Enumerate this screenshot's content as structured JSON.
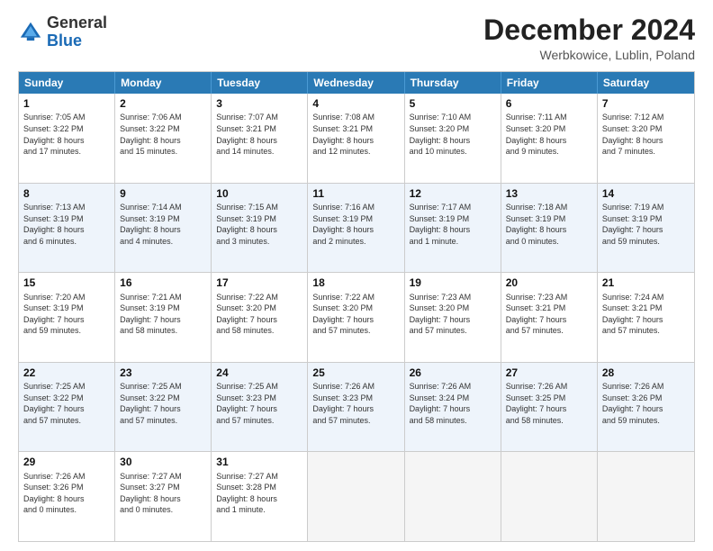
{
  "header": {
    "logo_general": "General",
    "logo_blue": "Blue",
    "month_title": "December 2024",
    "location": "Werbkowice, Lublin, Poland"
  },
  "weekdays": [
    "Sunday",
    "Monday",
    "Tuesday",
    "Wednesday",
    "Thursday",
    "Friday",
    "Saturday"
  ],
  "rows": [
    [
      {
        "day": "1",
        "lines": [
          "Sunrise: 7:05 AM",
          "Sunset: 3:22 PM",
          "Daylight: 8 hours",
          "and 17 minutes."
        ]
      },
      {
        "day": "2",
        "lines": [
          "Sunrise: 7:06 AM",
          "Sunset: 3:22 PM",
          "Daylight: 8 hours",
          "and 15 minutes."
        ]
      },
      {
        "day": "3",
        "lines": [
          "Sunrise: 7:07 AM",
          "Sunset: 3:21 PM",
          "Daylight: 8 hours",
          "and 14 minutes."
        ]
      },
      {
        "day": "4",
        "lines": [
          "Sunrise: 7:08 AM",
          "Sunset: 3:21 PM",
          "Daylight: 8 hours",
          "and 12 minutes."
        ]
      },
      {
        "day": "5",
        "lines": [
          "Sunrise: 7:10 AM",
          "Sunset: 3:20 PM",
          "Daylight: 8 hours",
          "and 10 minutes."
        ]
      },
      {
        "day": "6",
        "lines": [
          "Sunrise: 7:11 AM",
          "Sunset: 3:20 PM",
          "Daylight: 8 hours",
          "and 9 minutes."
        ]
      },
      {
        "day": "7",
        "lines": [
          "Sunrise: 7:12 AM",
          "Sunset: 3:20 PM",
          "Daylight: 8 hours",
          "and 7 minutes."
        ]
      }
    ],
    [
      {
        "day": "8",
        "lines": [
          "Sunrise: 7:13 AM",
          "Sunset: 3:19 PM",
          "Daylight: 8 hours",
          "and 6 minutes."
        ]
      },
      {
        "day": "9",
        "lines": [
          "Sunrise: 7:14 AM",
          "Sunset: 3:19 PM",
          "Daylight: 8 hours",
          "and 4 minutes."
        ]
      },
      {
        "day": "10",
        "lines": [
          "Sunrise: 7:15 AM",
          "Sunset: 3:19 PM",
          "Daylight: 8 hours",
          "and 3 minutes."
        ]
      },
      {
        "day": "11",
        "lines": [
          "Sunrise: 7:16 AM",
          "Sunset: 3:19 PM",
          "Daylight: 8 hours",
          "and 2 minutes."
        ]
      },
      {
        "day": "12",
        "lines": [
          "Sunrise: 7:17 AM",
          "Sunset: 3:19 PM",
          "Daylight: 8 hours",
          "and 1 minute."
        ]
      },
      {
        "day": "13",
        "lines": [
          "Sunrise: 7:18 AM",
          "Sunset: 3:19 PM",
          "Daylight: 8 hours",
          "and 0 minutes."
        ]
      },
      {
        "day": "14",
        "lines": [
          "Sunrise: 7:19 AM",
          "Sunset: 3:19 PM",
          "Daylight: 7 hours",
          "and 59 minutes."
        ]
      }
    ],
    [
      {
        "day": "15",
        "lines": [
          "Sunrise: 7:20 AM",
          "Sunset: 3:19 PM",
          "Daylight: 7 hours",
          "and 59 minutes."
        ]
      },
      {
        "day": "16",
        "lines": [
          "Sunrise: 7:21 AM",
          "Sunset: 3:19 PM",
          "Daylight: 7 hours",
          "and 58 minutes."
        ]
      },
      {
        "day": "17",
        "lines": [
          "Sunrise: 7:22 AM",
          "Sunset: 3:20 PM",
          "Daylight: 7 hours",
          "and 58 minutes."
        ]
      },
      {
        "day": "18",
        "lines": [
          "Sunrise: 7:22 AM",
          "Sunset: 3:20 PM",
          "Daylight: 7 hours",
          "and 57 minutes."
        ]
      },
      {
        "day": "19",
        "lines": [
          "Sunrise: 7:23 AM",
          "Sunset: 3:20 PM",
          "Daylight: 7 hours",
          "and 57 minutes."
        ]
      },
      {
        "day": "20",
        "lines": [
          "Sunrise: 7:23 AM",
          "Sunset: 3:21 PM",
          "Daylight: 7 hours",
          "and 57 minutes."
        ]
      },
      {
        "day": "21",
        "lines": [
          "Sunrise: 7:24 AM",
          "Sunset: 3:21 PM",
          "Daylight: 7 hours",
          "and 57 minutes."
        ]
      }
    ],
    [
      {
        "day": "22",
        "lines": [
          "Sunrise: 7:25 AM",
          "Sunset: 3:22 PM",
          "Daylight: 7 hours",
          "and 57 minutes."
        ]
      },
      {
        "day": "23",
        "lines": [
          "Sunrise: 7:25 AM",
          "Sunset: 3:22 PM",
          "Daylight: 7 hours",
          "and 57 minutes."
        ]
      },
      {
        "day": "24",
        "lines": [
          "Sunrise: 7:25 AM",
          "Sunset: 3:23 PM",
          "Daylight: 7 hours",
          "and 57 minutes."
        ]
      },
      {
        "day": "25",
        "lines": [
          "Sunrise: 7:26 AM",
          "Sunset: 3:23 PM",
          "Daylight: 7 hours",
          "and 57 minutes."
        ]
      },
      {
        "day": "26",
        "lines": [
          "Sunrise: 7:26 AM",
          "Sunset: 3:24 PM",
          "Daylight: 7 hours",
          "and 58 minutes."
        ]
      },
      {
        "day": "27",
        "lines": [
          "Sunrise: 7:26 AM",
          "Sunset: 3:25 PM",
          "Daylight: 7 hours",
          "and 58 minutes."
        ]
      },
      {
        "day": "28",
        "lines": [
          "Sunrise: 7:26 AM",
          "Sunset: 3:26 PM",
          "Daylight: 7 hours",
          "and 59 minutes."
        ]
      }
    ],
    [
      {
        "day": "29",
        "lines": [
          "Sunrise: 7:26 AM",
          "Sunset: 3:26 PM",
          "Daylight: 8 hours",
          "and 0 minutes."
        ]
      },
      {
        "day": "30",
        "lines": [
          "Sunrise: 7:27 AM",
          "Sunset: 3:27 PM",
          "Daylight: 8 hours",
          "and 0 minutes."
        ]
      },
      {
        "day": "31",
        "lines": [
          "Sunrise: 7:27 AM",
          "Sunset: 3:28 PM",
          "Daylight: 8 hours",
          "and 1 minute."
        ]
      },
      {
        "day": "",
        "lines": []
      },
      {
        "day": "",
        "lines": []
      },
      {
        "day": "",
        "lines": []
      },
      {
        "day": "",
        "lines": []
      }
    ]
  ]
}
